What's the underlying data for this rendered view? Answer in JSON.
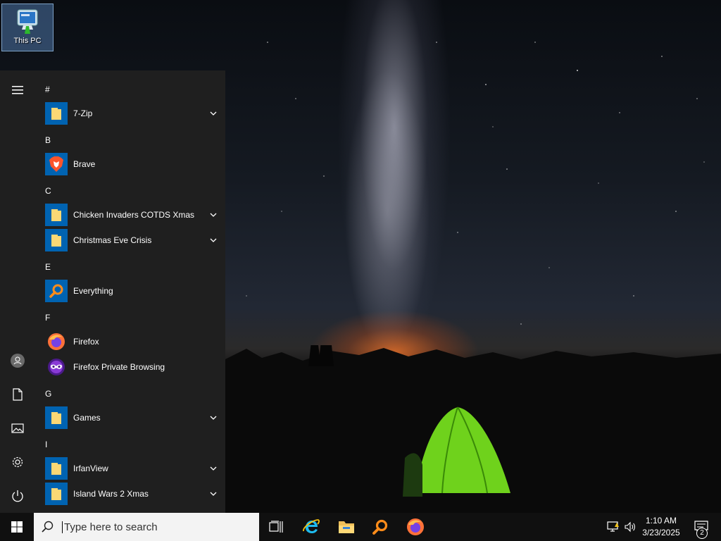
{
  "desktop": {
    "icons": [
      {
        "label": "This PC",
        "icon": "this-pc-icon"
      }
    ]
  },
  "start_menu": {
    "rail": [
      {
        "name": "hamburger-menu-icon"
      },
      {
        "name": "user-avatar-icon"
      },
      {
        "name": "documents-icon"
      },
      {
        "name": "pictures-icon"
      },
      {
        "name": "settings-gear-icon"
      },
      {
        "name": "power-icon"
      }
    ],
    "groups": [
      {
        "letter": "#",
        "apps": [
          {
            "name": "7-Zip",
            "icon": "folder-icon",
            "expandable": true
          }
        ]
      },
      {
        "letter": "B",
        "apps": [
          {
            "name": "Brave",
            "icon": "brave-icon",
            "expandable": false
          }
        ]
      },
      {
        "letter": "C",
        "apps": [
          {
            "name": "Chicken Invaders COTDS Xmas",
            "icon": "folder-icon",
            "expandable": true
          },
          {
            "name": "Christmas Eve Crisis",
            "icon": "folder-icon",
            "expandable": true
          }
        ]
      },
      {
        "letter": "E",
        "apps": [
          {
            "name": "Everything",
            "icon": "everything-search-icon",
            "expandable": false
          }
        ]
      },
      {
        "letter": "F",
        "apps": [
          {
            "name": "Firefox",
            "icon": "firefox-icon",
            "expandable": false
          },
          {
            "name": "Firefox Private Browsing",
            "icon": "firefox-private-icon",
            "expandable": false
          }
        ]
      },
      {
        "letter": "G",
        "apps": [
          {
            "name": "Games",
            "icon": "folder-icon",
            "expandable": true
          }
        ]
      },
      {
        "letter": "I",
        "apps": [
          {
            "name": "IrfanView",
            "icon": "folder-icon",
            "expandable": true
          },
          {
            "name": "Island Wars 2 Xmas",
            "icon": "folder-icon",
            "expandable": true
          }
        ]
      }
    ]
  },
  "taskbar": {
    "search_placeholder": "Type here to search",
    "pinned": [
      {
        "name": "task-view-icon"
      },
      {
        "name": "internet-explorer-icon"
      },
      {
        "name": "file-explorer-icon"
      },
      {
        "name": "everything-search-icon"
      },
      {
        "name": "firefox-icon"
      }
    ],
    "tray": {
      "time": "1:10 AM",
      "date": "3/23/2025",
      "notification_count": "2"
    }
  },
  "colors": {
    "start_bg": "#1f1f1f",
    "tile_blue": "#0063b1",
    "taskbar_bg": "#101010",
    "search_bg": "#f3f3f3"
  }
}
